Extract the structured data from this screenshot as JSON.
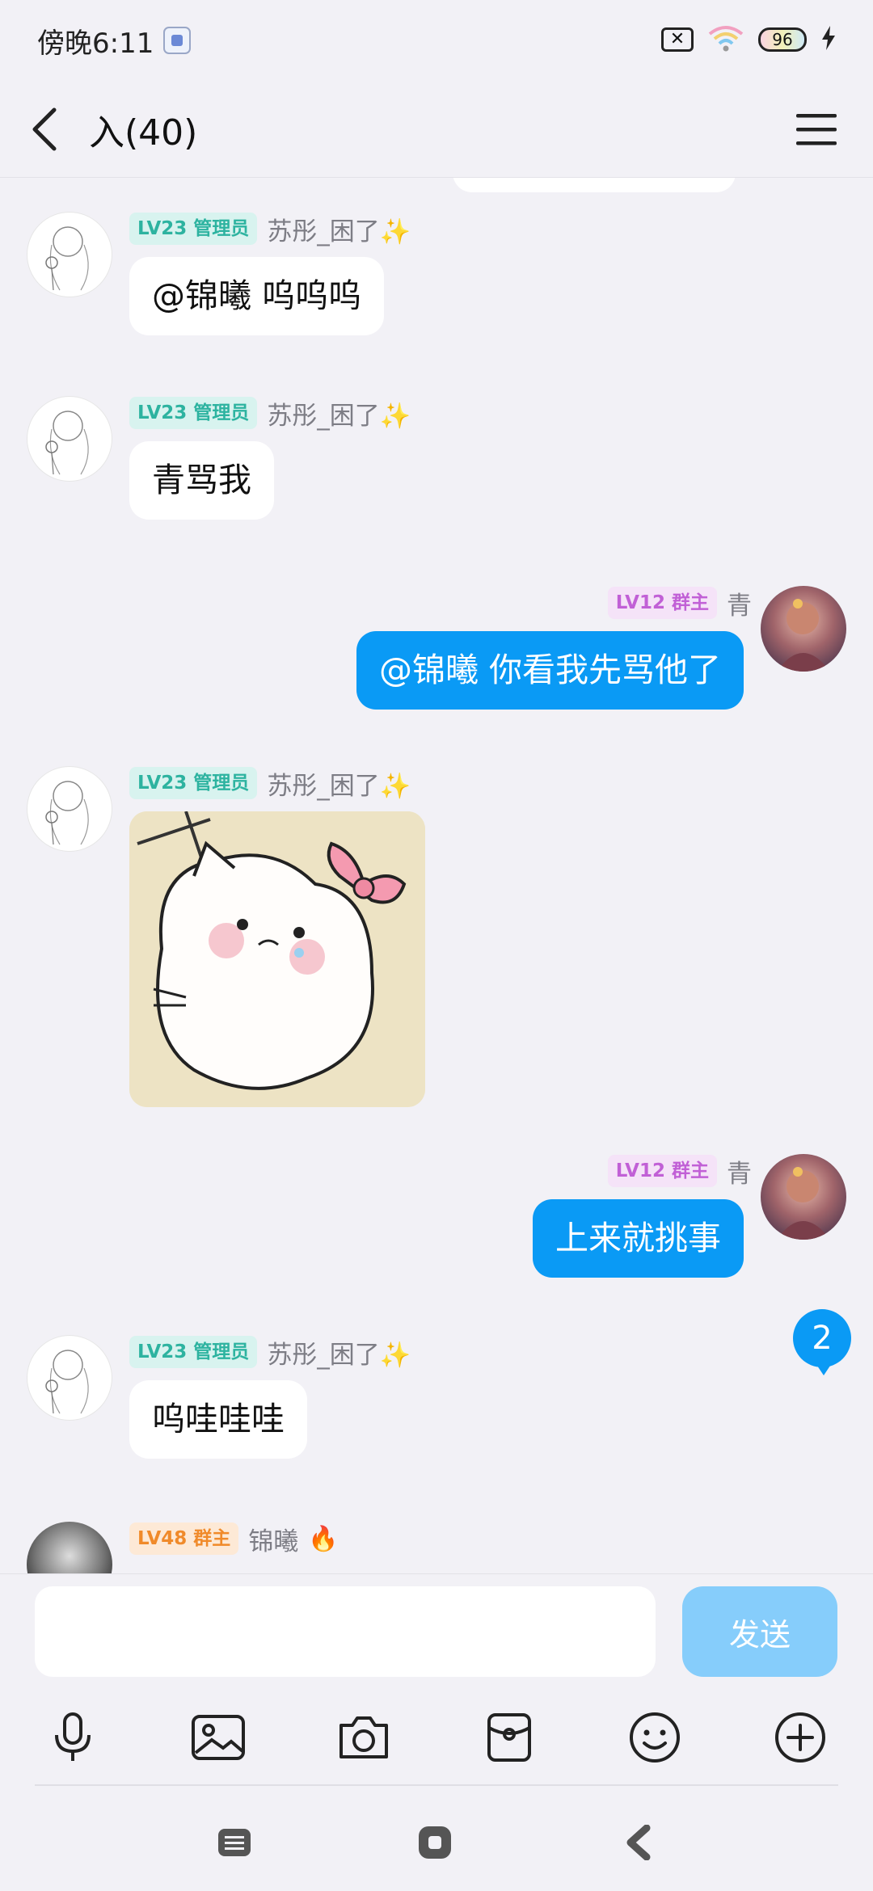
{
  "status_bar": {
    "time": "傍晚6:11",
    "battery": "96"
  },
  "header": {
    "title": "入(40)"
  },
  "messages": [
    {
      "side": "left",
      "level_tag": "LV23 管理员",
      "nickname": "苏彤_困了✨",
      "text": "@锦曦 呜呜呜"
    },
    {
      "side": "left",
      "level_tag": "LV23 管理员",
      "nickname": "苏彤_困了✨",
      "text": "青骂我"
    },
    {
      "side": "right",
      "level_tag": "LV12 群主",
      "nickname": "青",
      "text": "@锦曦 你看我先骂他了"
    },
    {
      "side": "left",
      "level_tag": "LV23 管理员",
      "nickname": "苏彤_困了✨",
      "sticker": "crying-kitty-sticker"
    },
    {
      "side": "right",
      "level_tag": "LV12 群主",
      "nickname": "青",
      "text": "上来就挑事"
    },
    {
      "side": "left",
      "level_tag": "LV23 管理员",
      "nickname": "苏彤_困了✨",
      "text": "呜哇哇哇"
    },
    {
      "side": "left",
      "level_tag": "LV48 群主",
      "nickname": "锦曦"
    }
  ],
  "unread_badge": "2",
  "input": {
    "value": "",
    "send_label": "发送"
  },
  "toolbar": [
    "microphone-icon",
    "image-icon",
    "camera-icon",
    "red-packet-icon",
    "emoji-icon",
    "plus-icon"
  ],
  "colors": {
    "accent": "#0a9af5",
    "send_disabled": "#86cdfb",
    "background": "#f2f1f6"
  }
}
